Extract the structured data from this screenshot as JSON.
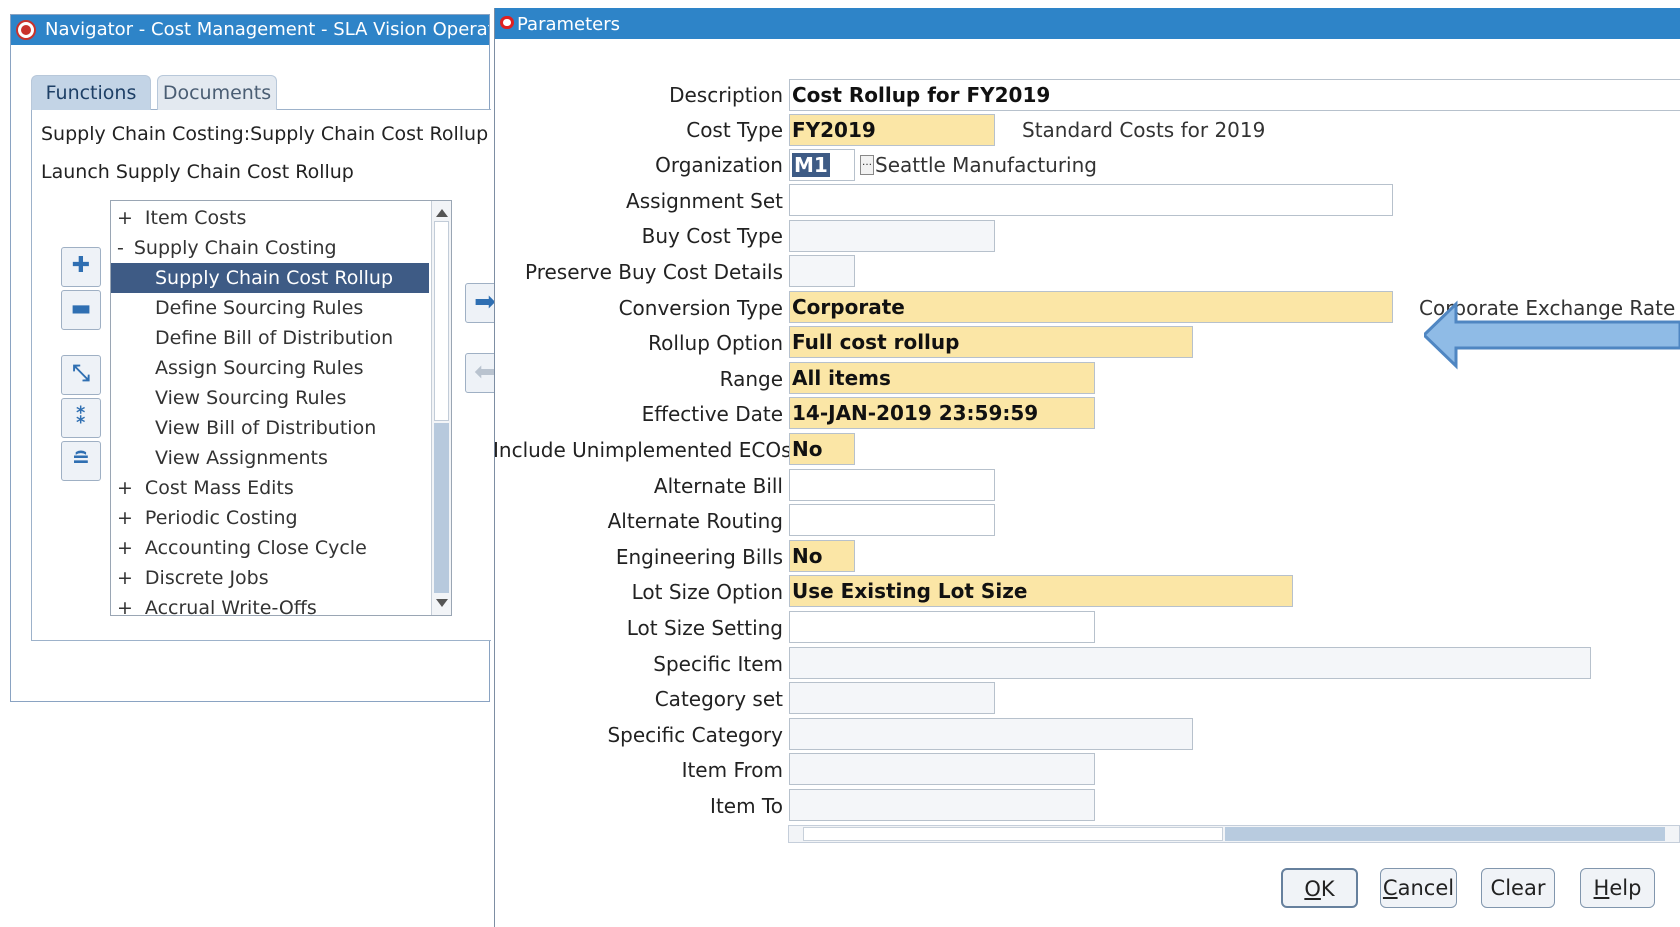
{
  "navigator": {
    "title": "Navigator - Cost Management - SLA Vision Operations",
    "tabs": [
      "Functions",
      "Documents"
    ],
    "breadcrumb": "Supply Chain Costing:Supply Chain Cost Rollup",
    "launch_text": "Launch Supply Chain Cost Rollup",
    "tree": [
      {
        "prefix": "+",
        "label": "Item Costs",
        "level": 0
      },
      {
        "prefix": "-",
        "label": "Supply Chain Costing",
        "level": 0
      },
      {
        "prefix": "",
        "label": "Supply Chain Cost Rollup",
        "level": 1,
        "selected": true
      },
      {
        "prefix": "",
        "label": "Define Sourcing Rules",
        "level": 1
      },
      {
        "prefix": "",
        "label": "Define Bill of Distribution",
        "level": 1
      },
      {
        "prefix": "",
        "label": "Assign Sourcing Rules",
        "level": 1
      },
      {
        "prefix": "",
        "label": "View Sourcing Rules",
        "level": 1
      },
      {
        "prefix": "",
        "label": "View Bill of Distribution",
        "level": 1
      },
      {
        "prefix": "",
        "label": "View Assignments",
        "level": 1
      },
      {
        "prefix": "+",
        "label": "Cost Mass Edits",
        "level": 0
      },
      {
        "prefix": "+",
        "label": "Periodic Costing",
        "level": 0
      },
      {
        "prefix": "+",
        "label": "Accounting Close Cycle",
        "level": 0
      },
      {
        "prefix": "+",
        "label": "Discrete Jobs",
        "level": 0
      },
      {
        "prefix": "+",
        "label": "Accrual Write-Offs",
        "level": 0
      }
    ]
  },
  "parameters": {
    "title": "Parameters",
    "fields": {
      "description": {
        "label": "Description",
        "value": "Cost Rollup for FY2019"
      },
      "cost_type": {
        "label": "Cost Type",
        "value": "FY2019",
        "desc": "Standard Costs for 2019"
      },
      "organization": {
        "label": "Organization",
        "value": "M1",
        "desc": "Seattle Manufacturing"
      },
      "assignment_set": {
        "label": "Assignment Set",
        "value": ""
      },
      "buy_cost_type": {
        "label": "Buy Cost Type",
        "value": ""
      },
      "preserve_buy_cost_details": {
        "label": "Preserve Buy Cost Details",
        "value": ""
      },
      "conversion_type": {
        "label": "Conversion Type",
        "value": "Corporate",
        "desc": "Corporate Exchange Rate"
      },
      "rollup_option": {
        "label": "Rollup Option",
        "value": "Full cost rollup"
      },
      "range": {
        "label": "Range",
        "value": "All items"
      },
      "effective_date": {
        "label": "Effective Date",
        "value": "14-JAN-2019 23:59:59"
      },
      "include_unimplemented_ecos": {
        "label": "Include Unimplemented ECOs",
        "value": "No"
      },
      "alternate_bill": {
        "label": "Alternate Bill",
        "value": ""
      },
      "alternate_routing": {
        "label": "Alternate Routing",
        "value": ""
      },
      "engineering_bills": {
        "label": "Engineering Bills",
        "value": "No"
      },
      "lot_size_option": {
        "label": "Lot Size Option",
        "value": "Use Existing Lot Size"
      },
      "lot_size_setting": {
        "label": "Lot Size Setting",
        "value": ""
      },
      "specific_item": {
        "label": "Specific Item",
        "value": ""
      },
      "category_set": {
        "label": "Category set",
        "value": ""
      },
      "specific_category": {
        "label": "Specific Category",
        "value": ""
      },
      "item_from": {
        "label": "Item From",
        "value": ""
      },
      "item_to": {
        "label": "Item To",
        "value": ""
      }
    },
    "buttons": {
      "ok": {
        "mnemonic": "O",
        "rest": "K"
      },
      "cancel": {
        "mnemonic": "C",
        "rest": "ancel"
      },
      "clear": {
        "mnemonic": "",
        "rest": "Clear"
      },
      "help": {
        "mnemonic": "H",
        "rest": "elp"
      }
    }
  },
  "colors": {
    "title_bar": "#2e84c8",
    "required_field": "#fbe6a6",
    "selection": "#3e5b85",
    "arrow": "#8fbbe6"
  },
  "icons": [
    "oracle-logo-icon",
    "oracle-o-icon",
    "expand-icon",
    "collapse-icon",
    "expand-all-icon",
    "expand-branch-icon",
    "collapse-all-icon",
    "add-to-top-ten-icon",
    "remove-from-top-ten-icon",
    "lov-icon",
    "pointer-arrow-icon"
  ]
}
